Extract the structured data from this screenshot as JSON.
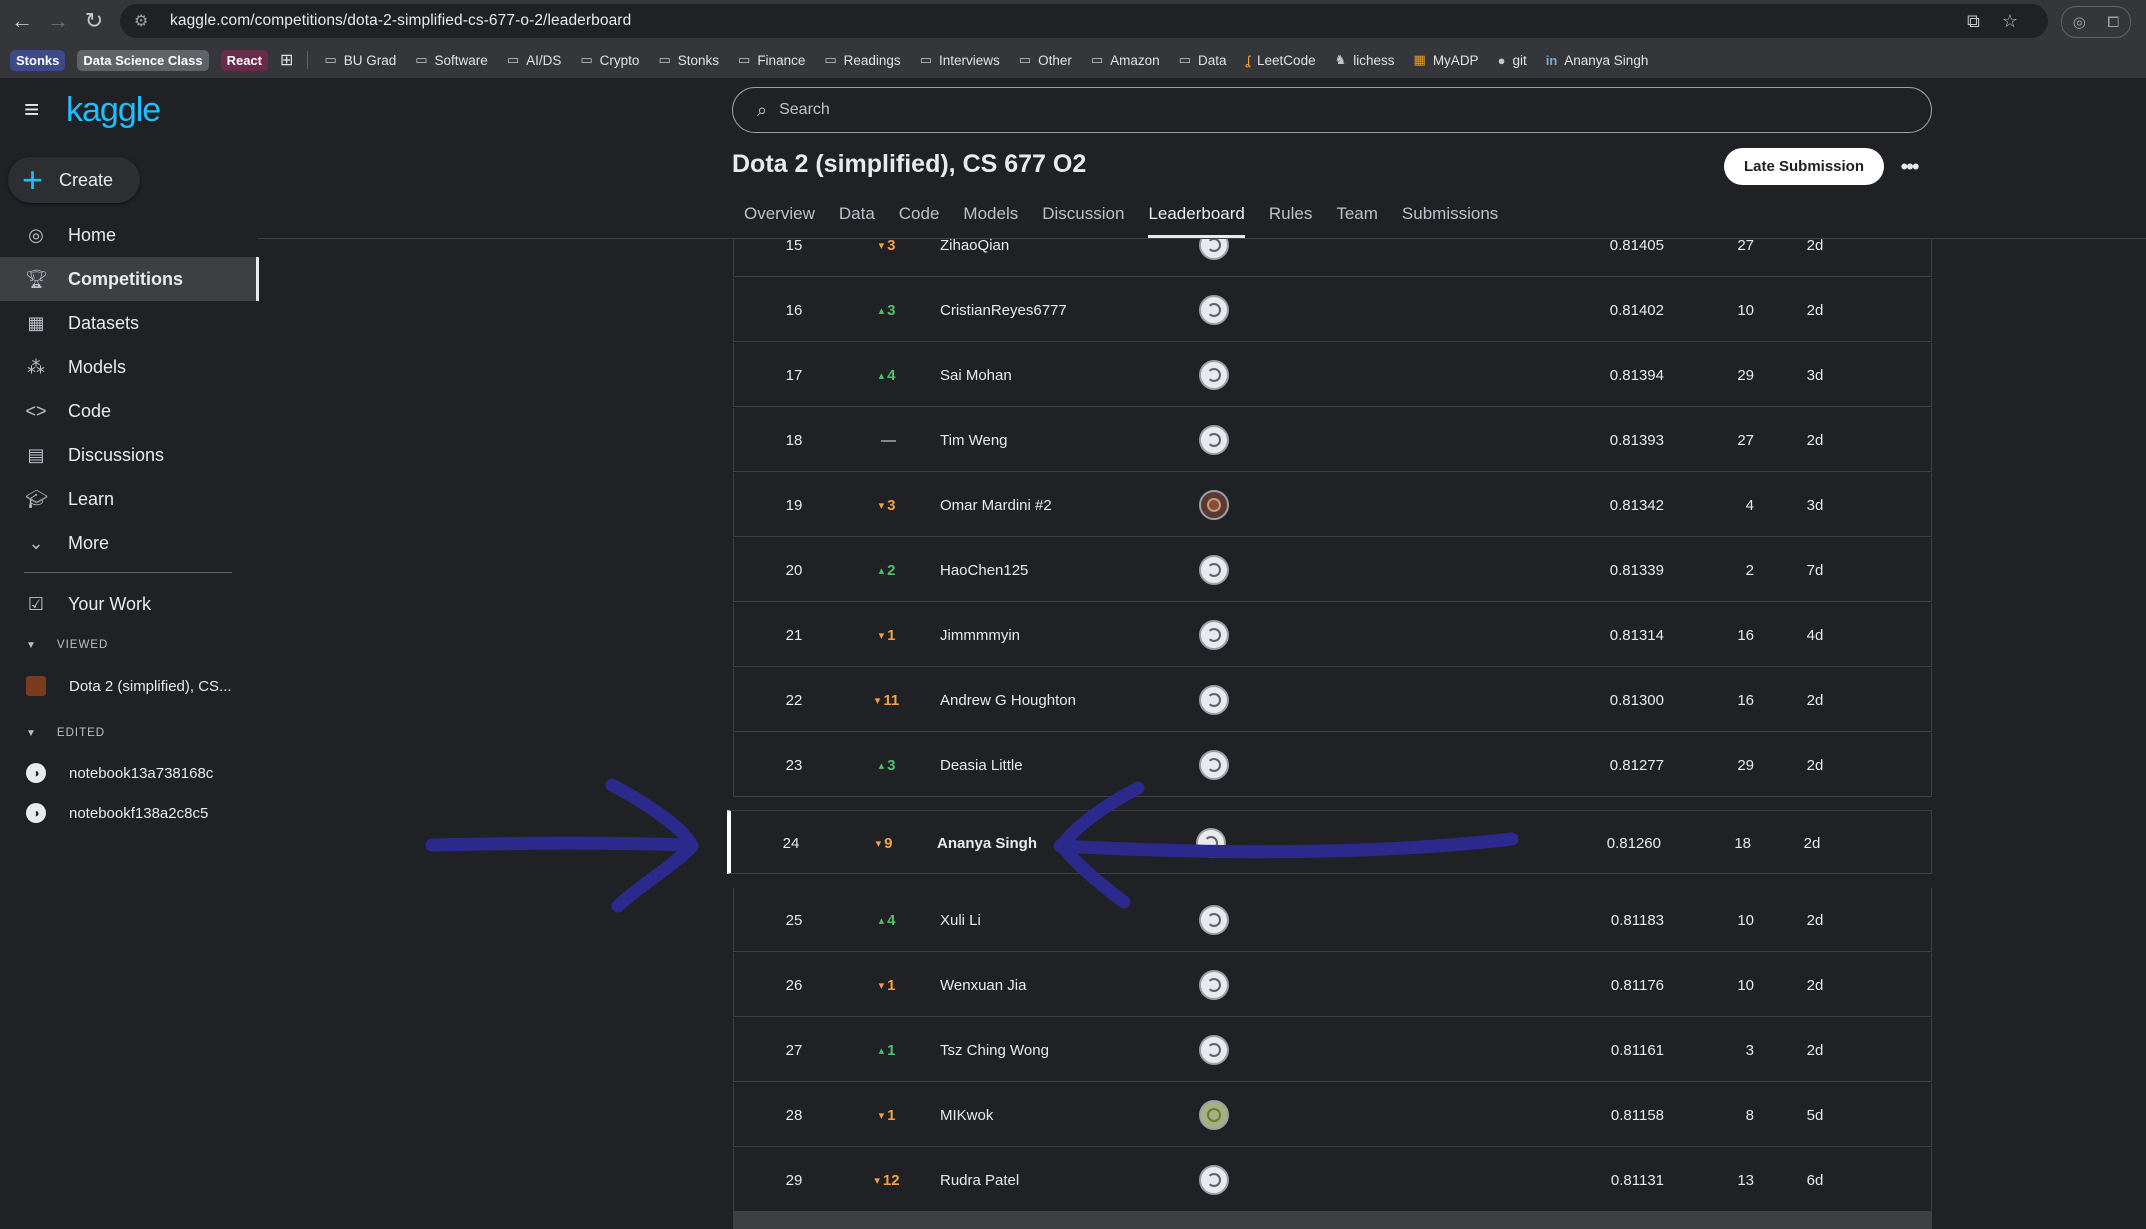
{
  "browser": {
    "url": "kaggle.com/competitions/dota-2-simplified-cs-677-o-2/leaderboard",
    "bookmarks_chips": [
      {
        "label": "Stonks",
        "bg": "#3b4a8a",
        "color": "#ffffff"
      },
      {
        "label": "Data Science Class",
        "bg": "#5f6368",
        "color": "#ffffff"
      },
      {
        "label": "React",
        "bg": "#6b2a4a",
        "color": "#ffffff"
      }
    ],
    "bookmarks": [
      "BU Grad",
      "Software",
      "AI/DS",
      "Crypto",
      "Stonks",
      "Finance",
      "Readings",
      "Interviews",
      "Other",
      "Amazon",
      "Data",
      "LeetCode",
      "lichess",
      "MyADP",
      "git",
      "Ananya Singh"
    ]
  },
  "sidebar": {
    "logo": "kaggle",
    "create_label": "Create",
    "items": [
      {
        "label": "Home",
        "icon": "compass-icon"
      },
      {
        "label": "Competitions",
        "icon": "trophy-icon"
      },
      {
        "label": "Datasets",
        "icon": "table-icon"
      },
      {
        "label": "Models",
        "icon": "models-icon"
      },
      {
        "label": "Code",
        "icon": "code-icon"
      },
      {
        "label": "Discussions",
        "icon": "discussion-icon"
      },
      {
        "label": "Learn",
        "icon": "learn-icon"
      },
      {
        "label": "More",
        "icon": "chevron-down-icon"
      },
      {
        "label": "Your Work",
        "icon": "your-work-icon"
      }
    ],
    "viewed_heading": "VIEWED",
    "viewed": [
      {
        "label": "Dota 2 (simplified), CS..."
      }
    ],
    "edited_heading": "EDITED",
    "edited": [
      {
        "label": "notebook13a738168c"
      },
      {
        "label": "notebookf138a2c8c5"
      }
    ]
  },
  "header": {
    "search_placeholder": "Search",
    "title": "Dota 2 (simplified), CS 677 O2",
    "late_submission_label": "Late Submission",
    "more_label": "•••",
    "tabs": [
      "Overview",
      "Data",
      "Code",
      "Models",
      "Discussion",
      "Leaderboard",
      "Rules",
      "Team",
      "Submissions"
    ],
    "active_tab": "Leaderboard"
  },
  "leaderboard": {
    "rows": [
      {
        "rank": "15",
        "dir": "down",
        "delta": "3",
        "team": "ZihaoQian",
        "avatar": "default",
        "score": "0.81405",
        "entries": "27",
        "last": "2d"
      },
      {
        "rank": "16",
        "dir": "up",
        "delta": "3",
        "team": "CristianReyes6777",
        "avatar": "default",
        "score": "0.81402",
        "entries": "10",
        "last": "2d"
      },
      {
        "rank": "17",
        "dir": "up",
        "delta": "4",
        "team": "Sai Mohan",
        "avatar": "default",
        "score": "0.81394",
        "entries": "29",
        "last": "3d"
      },
      {
        "rank": "18",
        "dir": "flat",
        "delta": "—",
        "team": "Tim Weng",
        "avatar": "default",
        "score": "0.81393",
        "entries": "27",
        "last": "2d"
      },
      {
        "rank": "19",
        "dir": "down",
        "delta": "3",
        "team": "Omar Mardini #2",
        "avatar": "photo",
        "score": "0.81342",
        "entries": "4",
        "last": "3d"
      },
      {
        "rank": "20",
        "dir": "up",
        "delta": "2",
        "team": "HaoChen125",
        "avatar": "default",
        "score": "0.81339",
        "entries": "2",
        "last": "7d"
      },
      {
        "rank": "21",
        "dir": "down",
        "delta": "1",
        "team": "Jimmmmyin",
        "avatar": "default",
        "score": "0.81314",
        "entries": "16",
        "last": "4d"
      },
      {
        "rank": "22",
        "dir": "down",
        "delta": "11",
        "team": "Andrew G Houghton",
        "avatar": "default",
        "score": "0.81300",
        "entries": "16",
        "last": "2d"
      },
      {
        "rank": "23",
        "dir": "up",
        "delta": "3",
        "team": "Deasia Little",
        "avatar": "default",
        "score": "0.81277",
        "entries": "29",
        "last": "2d"
      },
      {
        "rank": "24",
        "dir": "down",
        "delta": "9",
        "team": "Ananya Singh",
        "avatar": "default",
        "score": "0.81260",
        "entries": "18",
        "last": "2d",
        "me": true
      },
      {
        "rank": "25",
        "dir": "up",
        "delta": "4",
        "team": "Xuli Li",
        "avatar": "default",
        "score": "0.81183",
        "entries": "10",
        "last": "2d"
      },
      {
        "rank": "26",
        "dir": "down",
        "delta": "1",
        "team": "Wenxuan Jia",
        "avatar": "default",
        "score": "0.81176",
        "entries": "10",
        "last": "2d"
      },
      {
        "rank": "27",
        "dir": "up",
        "delta": "1",
        "team": "Tsz Ching Wong",
        "avatar": "default",
        "score": "0.81161",
        "entries": "3",
        "last": "2d"
      },
      {
        "rank": "28",
        "dir": "down",
        "delta": "1",
        "team": "MIKwok",
        "avatar": "green",
        "score": "0.81158",
        "entries": "8",
        "last": "5d"
      },
      {
        "rank": "29",
        "dir": "down",
        "delta": "12",
        "team": "Rudra Patel",
        "avatar": "default",
        "score": "0.81131",
        "entries": "13",
        "last": "6d"
      }
    ]
  },
  "colors": {
    "kaggle_blue": "#20beff",
    "up": "#4fc16b",
    "down": "#f2a14a",
    "annotation": "#2b2a8c"
  }
}
